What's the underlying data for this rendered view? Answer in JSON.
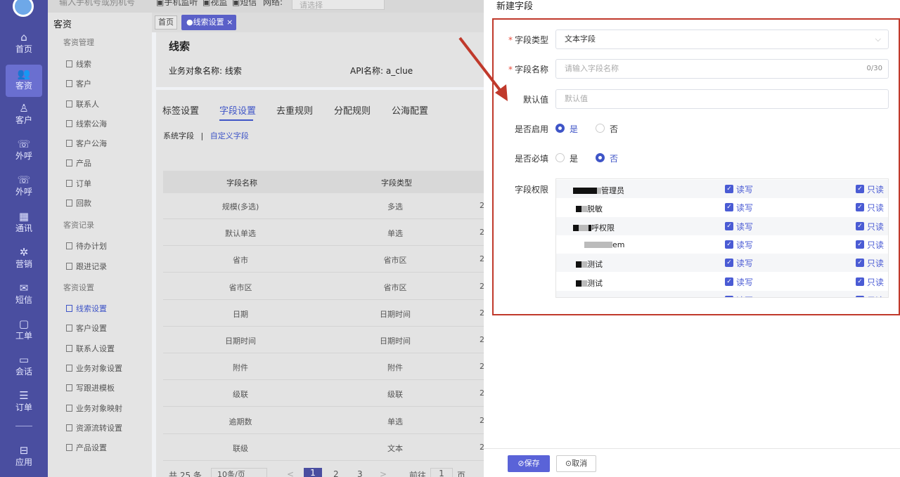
{
  "topbar": {
    "search_placeholder": "输入手机号或別机号",
    "phone_label": "手机监听",
    "monitor_label": "视监",
    "sms_label": "短信",
    "region_label": "网络:",
    "region_placeholder": "请选择"
  },
  "nav": {
    "items": [
      {
        "label": "首页",
        "icon": "home-icon",
        "glyph": "⌂"
      },
      {
        "label": "客资",
        "icon": "users-icon",
        "glyph": "👥"
      },
      {
        "label": "客户",
        "icon": "person-icon",
        "glyph": "♙"
      },
      {
        "label": "外呼",
        "icon": "phone-icon",
        "glyph": "☏"
      },
      {
        "label": "外呼",
        "icon": "phone-out-icon",
        "glyph": "☏"
      },
      {
        "label": "通讯",
        "icon": "calculator-icon",
        "glyph": "▦"
      },
      {
        "label": "营销",
        "icon": "gear-icon",
        "glyph": "✲"
      },
      {
        "label": "短信",
        "icon": "mail-icon",
        "glyph": "✉"
      },
      {
        "label": "工单",
        "icon": "clipboard-icon",
        "glyph": "▢"
      },
      {
        "label": "会话",
        "icon": "chat-icon",
        "glyph": "▭"
      },
      {
        "label": "订单",
        "icon": "list-icon",
        "glyph": "☰"
      },
      {
        "label": "应用",
        "icon": "apps-icon",
        "glyph": "⊟"
      }
    ],
    "active_index": 1
  },
  "sidebar": {
    "title": "客资",
    "groups": [
      {
        "label": "客资管理",
        "items": [
          "线索",
          "客户",
          "联系人",
          "线索公海",
          "客户公海",
          "产品",
          "订单",
          "回款"
        ]
      },
      {
        "label": "客资记录",
        "items": [
          "待办计划",
          "跟进记录"
        ]
      },
      {
        "label": "客资设置",
        "items": [
          "线索设置",
          "客户设置",
          "联系人设置",
          "业务对象设置",
          "写跟进模板",
          "业务对象映射",
          "资源流转设置",
          "产品设置"
        ]
      }
    ],
    "active_item": "线索设置"
  },
  "tabs": {
    "home": "首页",
    "active": "●线索设置 ×"
  },
  "page": {
    "title": "线索",
    "object_name": "业务对象名称: 线索",
    "api_name": "API名称: a_clue",
    "tabs": [
      "标签设置",
      "字段设置",
      "去重规则",
      "分配规则",
      "公海配置"
    ],
    "active_tab": "字段设置",
    "subtab_system": "系统字段",
    "subtab_sep": "|",
    "subtab_custom": "自定义字段"
  },
  "table": {
    "headers": [
      "字段名称",
      "字段类型"
    ],
    "rows": [
      [
        "规模(多选)",
        "多选"
      ],
      [
        "默认单选",
        "单选"
      ],
      [
        "省市",
        "省市区"
      ],
      [
        "省市区",
        "省市区"
      ],
      [
        "日期",
        "日期时间"
      ],
      [
        "日期时间",
        "日期时间"
      ],
      [
        "附件",
        "附件"
      ],
      [
        "级联",
        "级联"
      ],
      [
        "逾期数",
        "单选"
      ],
      [
        "联级",
        "文本"
      ]
    ],
    "edge_char": "2"
  },
  "pager": {
    "total": "共 25 条",
    "page_size": "10条/页",
    "prev": "<",
    "pages": [
      "1",
      "2",
      "3"
    ],
    "next": ">",
    "goto": "前往",
    "goto_value": "1",
    "page_unit": "页"
  },
  "drawer": {
    "title": "新建字段",
    "field_type_label": "字段类型",
    "field_type_value": "文本字段",
    "field_name_label": "字段名称",
    "field_name_placeholder": "请输入字段名称",
    "field_name_count": "0/30",
    "default_label": "默认值",
    "default_placeholder": "默认值",
    "enabled_label": "是否启用",
    "required_label": "是否必填",
    "yes": "是",
    "no": "否",
    "enabled_value": "是",
    "required_value": "否",
    "perm_label": "字段权限",
    "perm_rows": [
      "管理员",
      "脱敏",
      "呼权限",
      "em",
      "测试",
      "测试",
      "张组长测试"
    ],
    "rw_label": "读写",
    "ro_label": "只读",
    "save": "保存",
    "cancel": "取消",
    "save_icon": "check-circle-icon",
    "cancel_icon": "close-circle-icon"
  },
  "colors": {
    "nav_bg": "#4a4ea0",
    "accent": "#3f55c7",
    "annotation_red": "#c0392b"
  }
}
